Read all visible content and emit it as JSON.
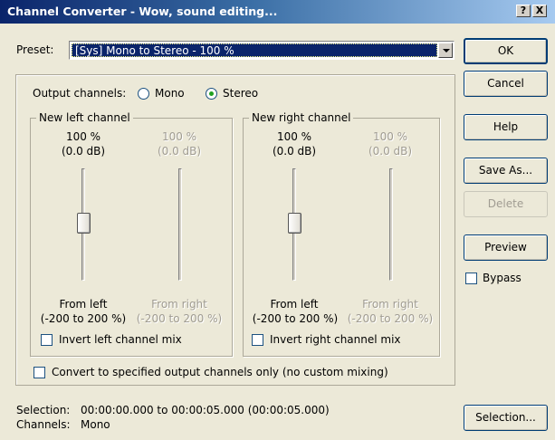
{
  "window": {
    "title": "Channel Converter - Wow, sound editing..."
  },
  "titlebar_buttons": {
    "help": "?",
    "close": "X"
  },
  "preset": {
    "label": "Preset:",
    "value": "[Sys] Mono to Stereo - 100 %"
  },
  "buttons": {
    "ok": "OK",
    "cancel": "Cancel",
    "help": "Help",
    "save_as": "Save As...",
    "delete": "Delete",
    "preview": "Preview",
    "bypass": "Bypass",
    "selection": "Selection..."
  },
  "output": {
    "label": "Output channels:",
    "mono": "Mono",
    "stereo": "Stereo",
    "selected": "Stereo"
  },
  "left_channel": {
    "title": "New left channel",
    "from_left": {
      "value_pct": "100 %",
      "value_db": "(0.0 dB)",
      "label": "From left",
      "range": "(-200 to 200 %)",
      "enabled": true
    },
    "from_right": {
      "value_pct": "100 %",
      "value_db": "(0.0 dB)",
      "label": "From right",
      "range": "(-200 to 200 %)",
      "enabled": false
    },
    "invert": "Invert left channel mix"
  },
  "right_channel": {
    "title": "New right channel",
    "from_left": {
      "value_pct": "100 %",
      "value_db": "(0.0 dB)",
      "label": "From left",
      "range": "(-200 to 200 %)",
      "enabled": true
    },
    "from_right": {
      "value_pct": "100 %",
      "value_db": "(0.0 dB)",
      "label": "From right",
      "range": "(-200 to 200 %)",
      "enabled": false
    },
    "invert": "Invert right channel mix"
  },
  "convert_only": "Convert to specified output channels only (no custom mixing)",
  "status": {
    "selection_label": "Selection:",
    "selection_value": "00:00:00.000 to 00:00:05.000 (00:00:05.000)",
    "channels_label": "Channels:",
    "channels_value": "Mono"
  }
}
